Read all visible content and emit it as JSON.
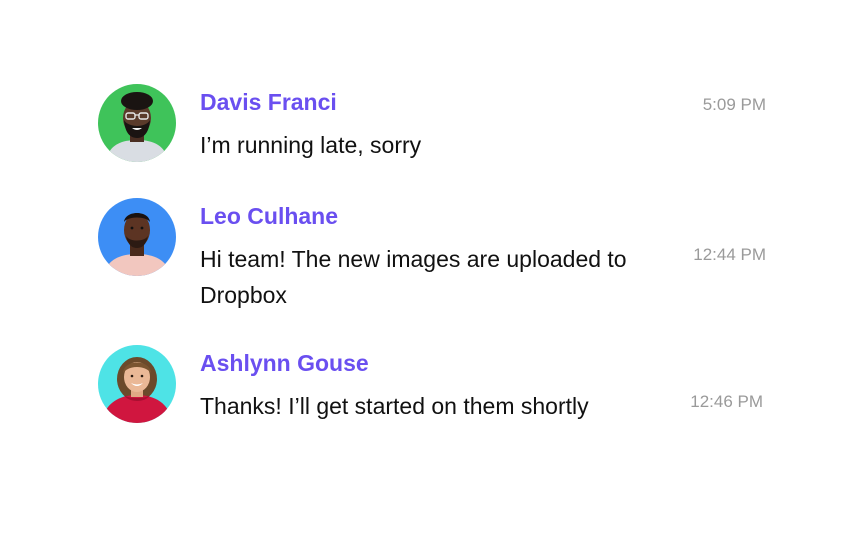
{
  "theme": {
    "sender_color": "#6a4ff0",
    "text_color": "#111111",
    "time_color": "#9a9a9a"
  },
  "messages": [
    {
      "sender": "Davis Franci",
      "text": "I’m running late, sorry",
      "time": "5:09 PM",
      "avatar_icon": "avatar-photo",
      "avatar_bg": "#3fc35a"
    },
    {
      "sender": "Leo Culhane",
      "text": "Hi team! The new images are uploaded to Dropbox",
      "time": "12:44 PM",
      "avatar_icon": "avatar-photo",
      "avatar_bg": "#3d8ef5"
    },
    {
      "sender": "Ashlynn Gouse",
      "text": "Thanks! I’ll get started on them shortly",
      "time": "12:46 PM",
      "avatar_icon": "avatar-photo",
      "avatar_bg": "#4ee3e6"
    }
  ]
}
